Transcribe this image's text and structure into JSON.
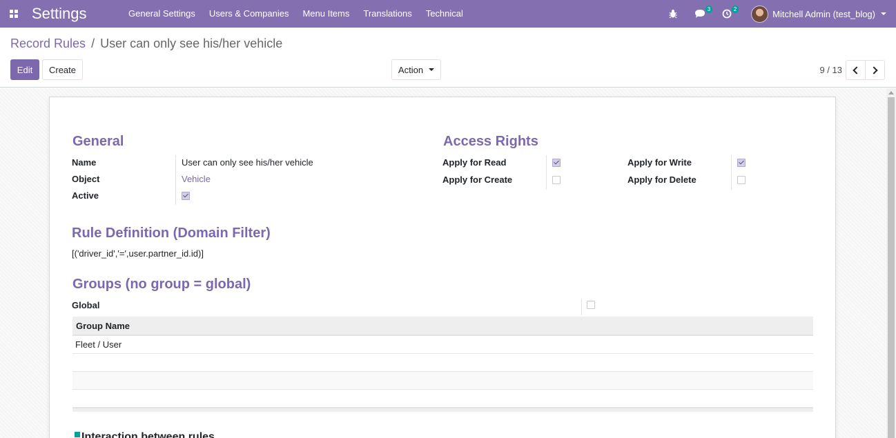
{
  "navbar": {
    "app_title": "Settings",
    "menu": [
      "General Settings",
      "Users & Companies",
      "Menu Items",
      "Translations",
      "Technical"
    ],
    "messages_count": "3",
    "activities_count": "2",
    "user_name": "Mitchell Admin (test_blog)",
    "accent_color": "#8470b0"
  },
  "breadcrumb": {
    "parent": "Record Rules",
    "separator": "/",
    "current": "User can only see his/her vehicle"
  },
  "buttons": {
    "edit": "Edit",
    "create": "Create",
    "action": "Action"
  },
  "pager": {
    "value": "9 / 13"
  },
  "form": {
    "general": {
      "title": "General",
      "name_label": "Name",
      "name_value": "User can only see his/her vehicle",
      "object_label": "Object",
      "object_value": "Vehicle",
      "active_label": "Active",
      "active_checked": true
    },
    "access_rights": {
      "title": "Access Rights",
      "read_label": "Apply for Read",
      "read_checked": true,
      "create_label": "Apply for Create",
      "create_checked": false,
      "write_label": "Apply for Write",
      "write_checked": true,
      "delete_label": "Apply for Delete",
      "delete_checked": false
    },
    "domain": {
      "title": "Rule Definition (Domain Filter)",
      "value": "[('driver_id','=',user.partner_id.id)]"
    },
    "groups": {
      "title": "Groups (no group = global)",
      "global_label": "Global",
      "global_checked": false,
      "column_header": "Group Name",
      "rows": [
        "Fleet / User",
        "",
        "",
        ""
      ]
    },
    "interaction": {
      "title": "Interaction between rules"
    }
  }
}
